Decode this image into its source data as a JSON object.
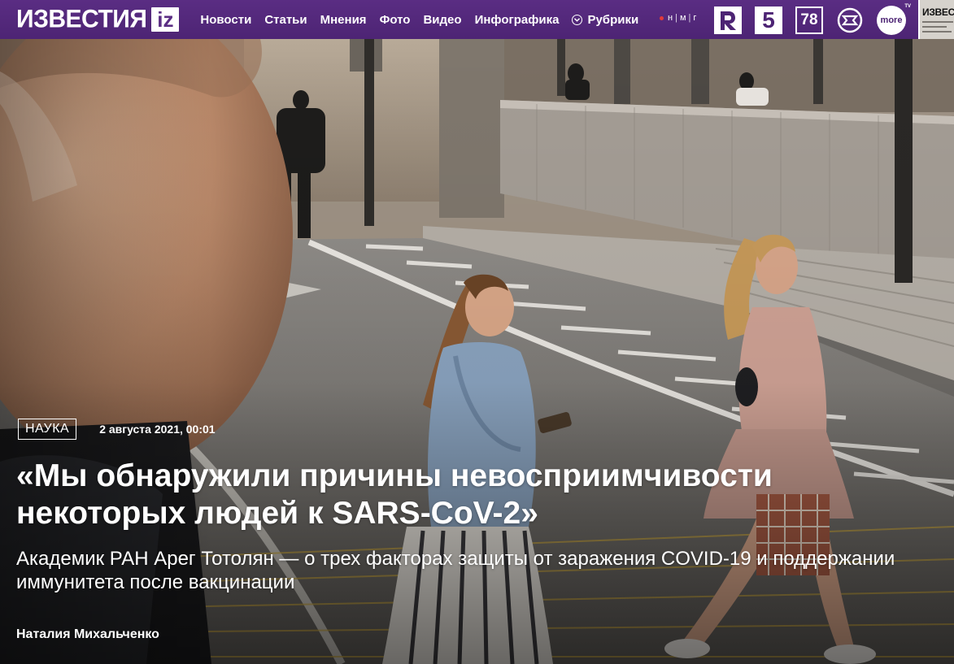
{
  "header": {
    "logo_text": "ИЗВЕСТИЯ",
    "logo_badge": "iz",
    "nav": [
      {
        "label": "Новости"
      },
      {
        "label": "Статьи"
      },
      {
        "label": "Мнения"
      },
      {
        "label": "Фото"
      },
      {
        "label": "Видео"
      },
      {
        "label": "Инфографика"
      }
    ],
    "rubrics_label": "Рубрики",
    "nmg": {
      "a": "н",
      "b": "м",
      "c": "г"
    },
    "channels": {
      "ch5": "5",
      "ch78": "78",
      "more": "more",
      "more_tv": "TV"
    },
    "newspaper_title": "ИЗВЕС"
  },
  "article": {
    "rubric": "НАУКА",
    "date": "2 августа 2021, 00:01",
    "title": "«Мы обнаружили причины невосприимчивости некоторых людей к SARS-CoV-2»",
    "subtitle": "Академик РАН Арег Тотолян — о трех факторах защиты от заражения COVID-19 и поддержании иммунитета после вакцинации",
    "author": "Наталия Михальченко"
  },
  "colors": {
    "header_bg": "#5a2d83",
    "text": "#ffffff"
  }
}
